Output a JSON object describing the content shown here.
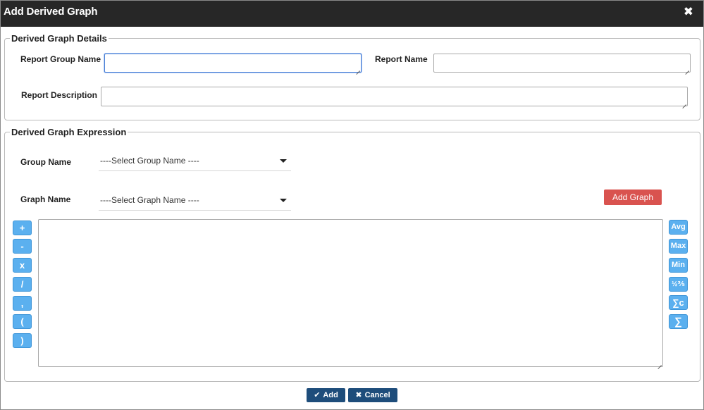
{
  "dialog": {
    "title": "Add Derived Graph",
    "close_glyph": "✖"
  },
  "details": {
    "legend": "Derived Graph Details",
    "report_group_name_label": "Report Group Name",
    "report_group_name_value": "",
    "report_name_label": "Report Name",
    "report_name_value": "",
    "report_description_label": "Report Description",
    "report_description_value": ""
  },
  "expression": {
    "legend": "Derived Graph Expression",
    "group_name_label": "Group Name",
    "group_name_selected": "----Select Group Name ----",
    "graph_name_label": "Graph Name",
    "graph_name_selected": "----Select Graph Name ----",
    "add_graph_label": "Add Graph",
    "expression_value": "",
    "operators": [
      "+",
      "-",
      "x",
      "/",
      ",",
      "(",
      ")"
    ],
    "functions": [
      "Avg",
      "Max",
      "Min",
      "½⅗",
      "∑c",
      "∑"
    ]
  },
  "footer": {
    "add_label": "Add",
    "cancel_label": "Cancel"
  },
  "colors": {
    "titlebar": "#272727",
    "add_graph": "#d9534f",
    "op_button": "#5bb0ef",
    "footer_button": "#1e4d7b"
  }
}
